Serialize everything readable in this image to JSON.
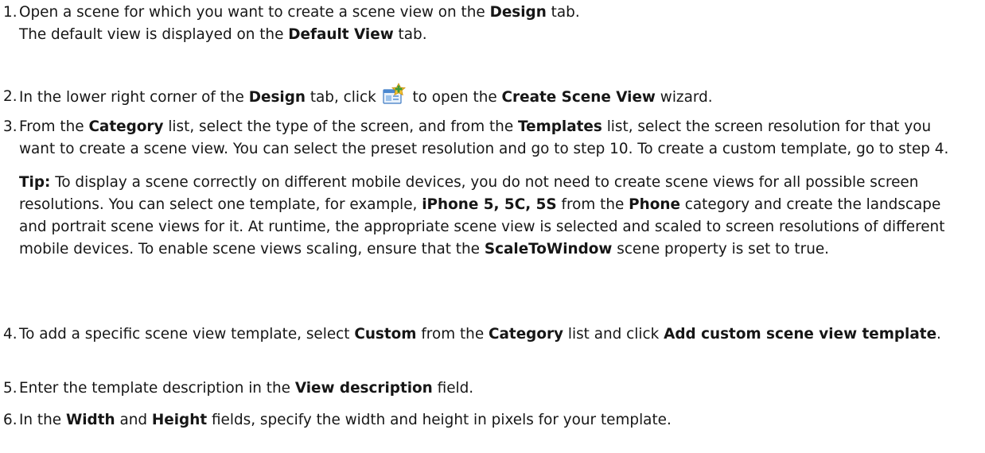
{
  "steps": [
    {
      "number": "1.",
      "text": [
        "Open a scene for which you want to create a scene view on the ",
        {
          "b": "Design"
        },
        " tab."
      ],
      "result": [
        "The default view is displayed on the ",
        {
          "b": "Default View"
        },
        " tab."
      ]
    },
    {
      "number": "2.",
      "text_before": [
        "In the lower right corner of the ",
        {
          "b": "Design"
        },
        " tab, click "
      ],
      "icon": "create-scene-view-icon",
      "text_after": [
        " to open the ",
        {
          "b": "Create Scene View"
        },
        " wizard."
      ]
    },
    {
      "number": "3.",
      "text": [
        "From the ",
        {
          "b": "Category"
        },
        " list, select the type of the screen, and from the ",
        {
          "b": "Templates"
        },
        " list, select the screen resolution for that you want to create a scene view. You can select the preset resolution and go to step 10. To create a custom template, go to step 4."
      ],
      "tip": [
        {
          "b": "Tip:"
        },
        " To display a scene correctly on different mobile devices, you do not need to create scene views for all possible screen resolutions. You can select one template, for example, ",
        {
          "b": "iPhone 5, 5C, 5S"
        },
        " from the ",
        {
          "b": "Phone"
        },
        " category and create the landscape and portrait scene views for it. At runtime, the appropriate scene view is selected and scaled to screen resolutions of different mobile devices. To enable scene views scaling, ensure that the ",
        {
          "b": "ScaleToWindow"
        },
        " scene property is set to true."
      ]
    },
    {
      "number": "4.",
      "text": [
        "To add a specific scene view template, select ",
        {
          "b": "Custom"
        },
        " from the ",
        {
          "b": "Category"
        },
        " list and click ",
        {
          "b": "Add custom scene view template"
        },
        "."
      ]
    },
    {
      "number": "5.",
      "text": [
        "Enter the template description in the ",
        {
          "b": "View description"
        },
        " field."
      ]
    },
    {
      "number": "6.",
      "text": [
        "In the ",
        {
          "b": "Width"
        },
        " and ",
        {
          "b": "Height"
        },
        " fields, specify the width and height in pixels for your template."
      ]
    }
  ]
}
